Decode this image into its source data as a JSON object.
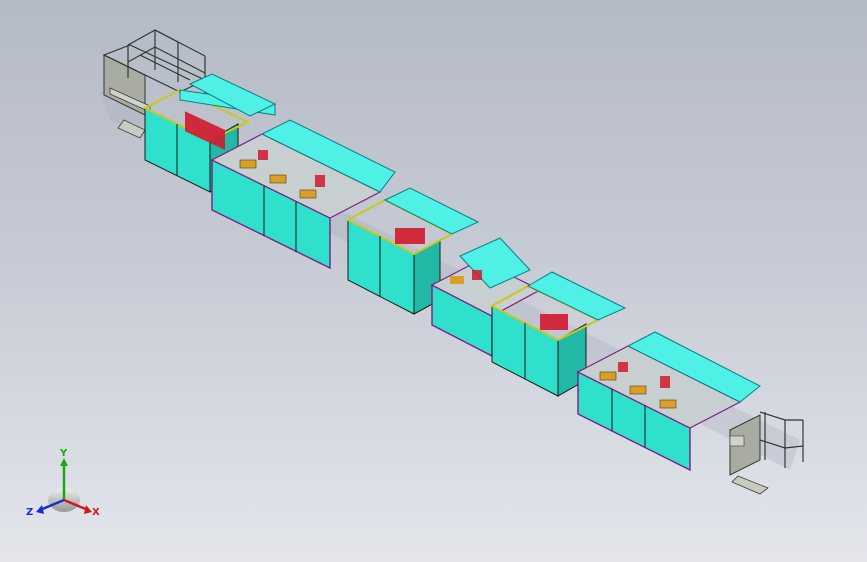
{
  "view": {
    "background_top": "#b4bac6",
    "background_bottom": "#e4e6ec"
  },
  "colors": {
    "panel": "#2fe0cc",
    "panel_dark": "#22b8a6",
    "roof": "#4ff0e6",
    "roof_line": "#0a7f86",
    "frame_yellow": "#c8c81e",
    "frame_purple": "#7a1f86",
    "machine_red": "#d01a2c",
    "machine_orange": "#d8a028",
    "conveyor_gray": "#a8aca2"
  },
  "triad": {
    "labels": {
      "y": "Y",
      "z": "Z",
      "x": "X"
    },
    "colors": {
      "y": "#1aa81a",
      "z": "#1a2fd0",
      "x": "#d01a1a"
    }
  }
}
